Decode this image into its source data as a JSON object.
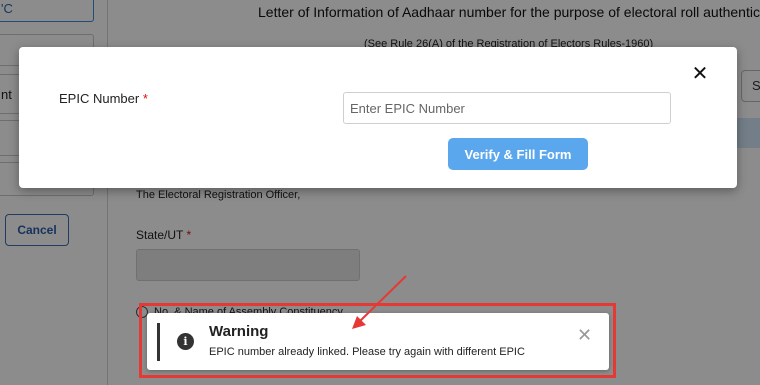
{
  "background": {
    "left_panel": {
      "top_item": "'C",
      "item_2": "nt",
      "cancel_label": "Cancel"
    },
    "doc_title": "Letter of Information of Aadhaar number for the purpose of electoral roll authentication",
    "doc_subtitle": "(See Rule 26(A) of the Registration of Electors Rules-1960)",
    "right_button_partial": "S",
    "addressee": "The Electoral Registration Officer,",
    "state_label": "State/UT",
    "required_mark": "*",
    "radio_label": "No. & Name of Assembly Constituency"
  },
  "modal": {
    "label": "EPIC Number",
    "required_mark": "*",
    "input_placeholder": "Enter EPIC Number",
    "input_value": "",
    "verify_button": "Verify & Fill Form",
    "close_glyph": "✕"
  },
  "toast": {
    "title": "Warning",
    "message": "EPIC number already linked. Please try again with different EPIC",
    "icon": "info-icon",
    "close_glyph": "✕"
  },
  "colors": {
    "accent": "#5aa7ee",
    "highlight": "#e53935"
  }
}
